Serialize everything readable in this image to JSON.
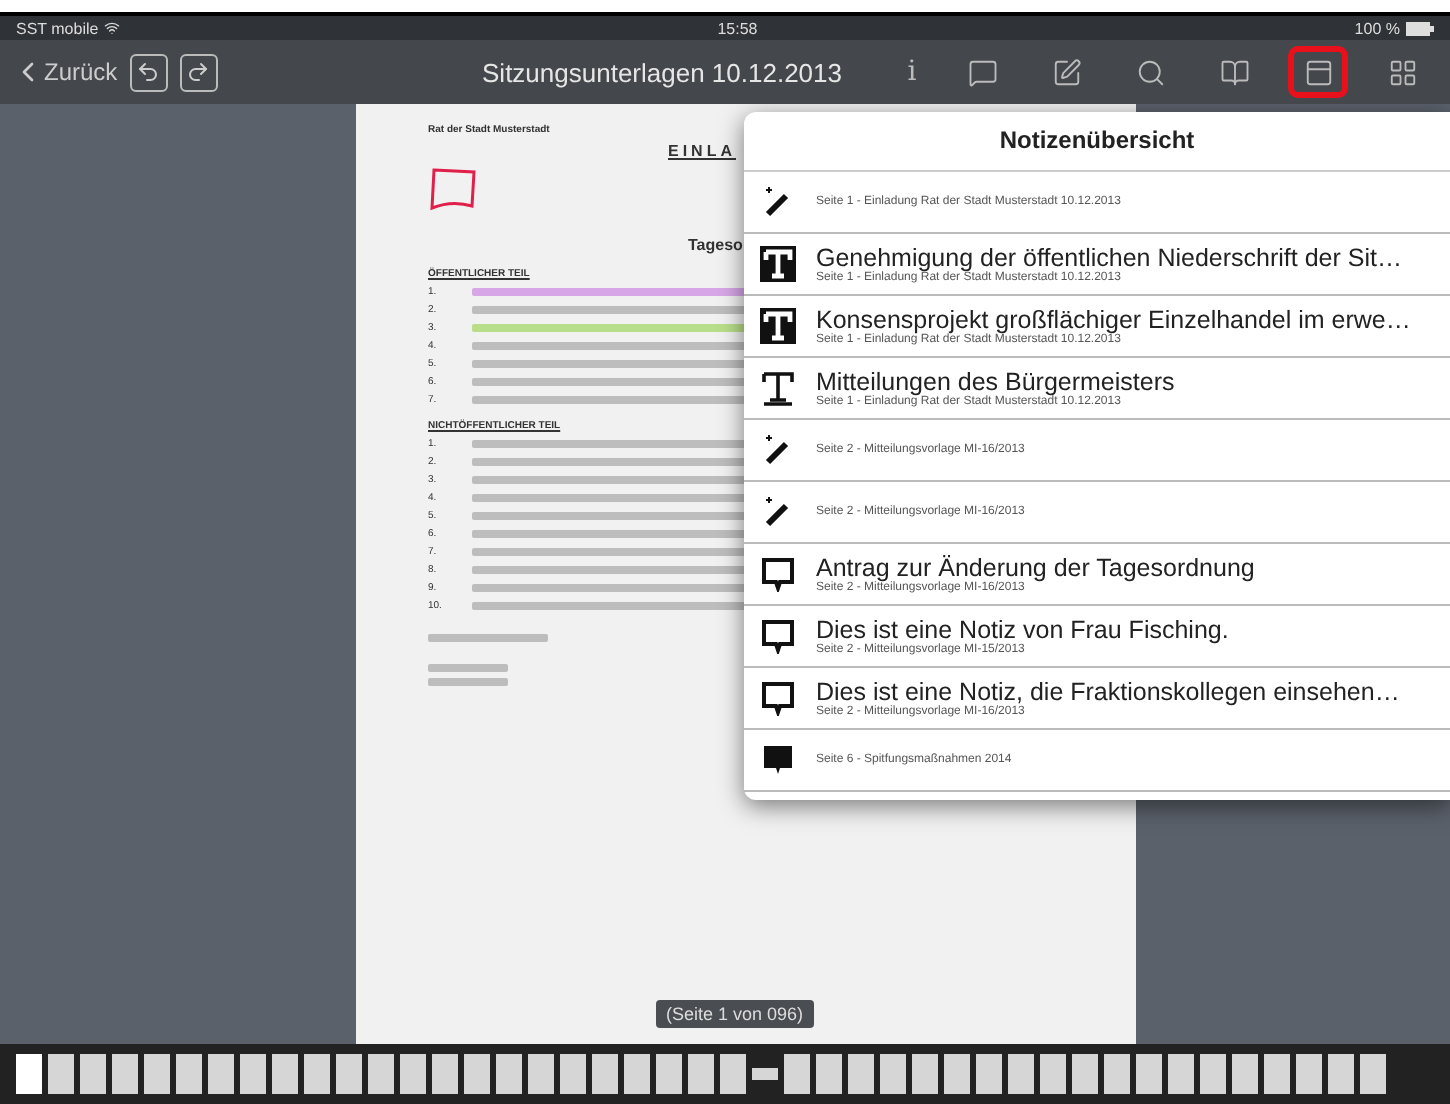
{
  "status_bar": {
    "carrier": "SST mobile",
    "time": "15:58",
    "battery": "100 %"
  },
  "toolbar": {
    "back": "Zurück",
    "title": "Sitzungsunterlagen 10.12.2013",
    "info": "i",
    "buttons": [
      {
        "kind": "comment",
        "selected": false
      },
      {
        "kind": "edit",
        "selected": false
      },
      {
        "kind": "search",
        "selected": false
      },
      {
        "kind": "book",
        "selected": false
      },
      {
        "kind": "notes",
        "selected": true
      },
      {
        "kind": "grid",
        "selected": false
      }
    ]
  },
  "document": {
    "sender": "Rat der Stadt Musterstadt",
    "heading": "EINLA",
    "agenda_heading": "Tageso",
    "public_section": "ÖFFENTLICHER TEIL",
    "public_items": [
      "1.",
      "2.",
      "3.",
      "4.",
      "5.",
      "6.",
      "7."
    ],
    "private_section": "NICHTÖFFENTLICHER TEIL",
    "private_items": [
      "1.",
      "2.",
      "3.",
      "4.",
      "5.",
      "6.",
      "7.",
      "8.",
      "9.",
      "10."
    ],
    "page_label": "(Seite 1 von 096)"
  },
  "notes": {
    "title": "Notizenübersicht",
    "items": [
      {
        "kind": "freehand",
        "subtitle": "Seite 1 - Einladung Rat der Stadt Musterstadt 10.12.2013"
      },
      {
        "kind": "text-filled",
        "title": "Genehmigung der öffentlichen Niederschrift der Sit…",
        "subtitle": "Seite 1 - Einladung Rat der Stadt Musterstadt 10.12.2013"
      },
      {
        "kind": "text-filled",
        "title": "Konsensprojekt großflächiger Einzelhandel im erwe…",
        "subtitle": "Seite 1 - Einladung Rat der Stadt Musterstadt 10.12.2013"
      },
      {
        "kind": "text",
        "title": "Mitteilungen des Bürgermeisters",
        "subtitle": "Seite 1 - Einladung Rat der Stadt Musterstadt 10.12.2013"
      },
      {
        "kind": "freehand",
        "subtitle": "Seite 2 - Mitteilungsvorlage MI-16/2013"
      },
      {
        "kind": "freehand",
        "subtitle": "Seite 2 - Mitteilungsvorlage MI-16/2013"
      },
      {
        "kind": "comment",
        "title": "Antrag zur Änderung der Tagesordnung",
        "subtitle": "Seite 2 - Mitteilungsvorlage MI-16/2013"
      },
      {
        "kind": "comment",
        "title": "Dies ist eine Notiz von Frau Fisching.",
        "subtitle": "Seite 2 - Mitteilungsvorlage MI-15/2013"
      },
      {
        "kind": "comment",
        "title": "Dies ist eine Notiz, die Fraktionskollegen einsehen…",
        "subtitle": "Seite 2 - Mitteilungsvorlage MI-16/2013"
      },
      {
        "kind": "comment-filled",
        "subtitle": "Seite 6 - Spitfungsmaßnahmen 2014"
      }
    ]
  }
}
